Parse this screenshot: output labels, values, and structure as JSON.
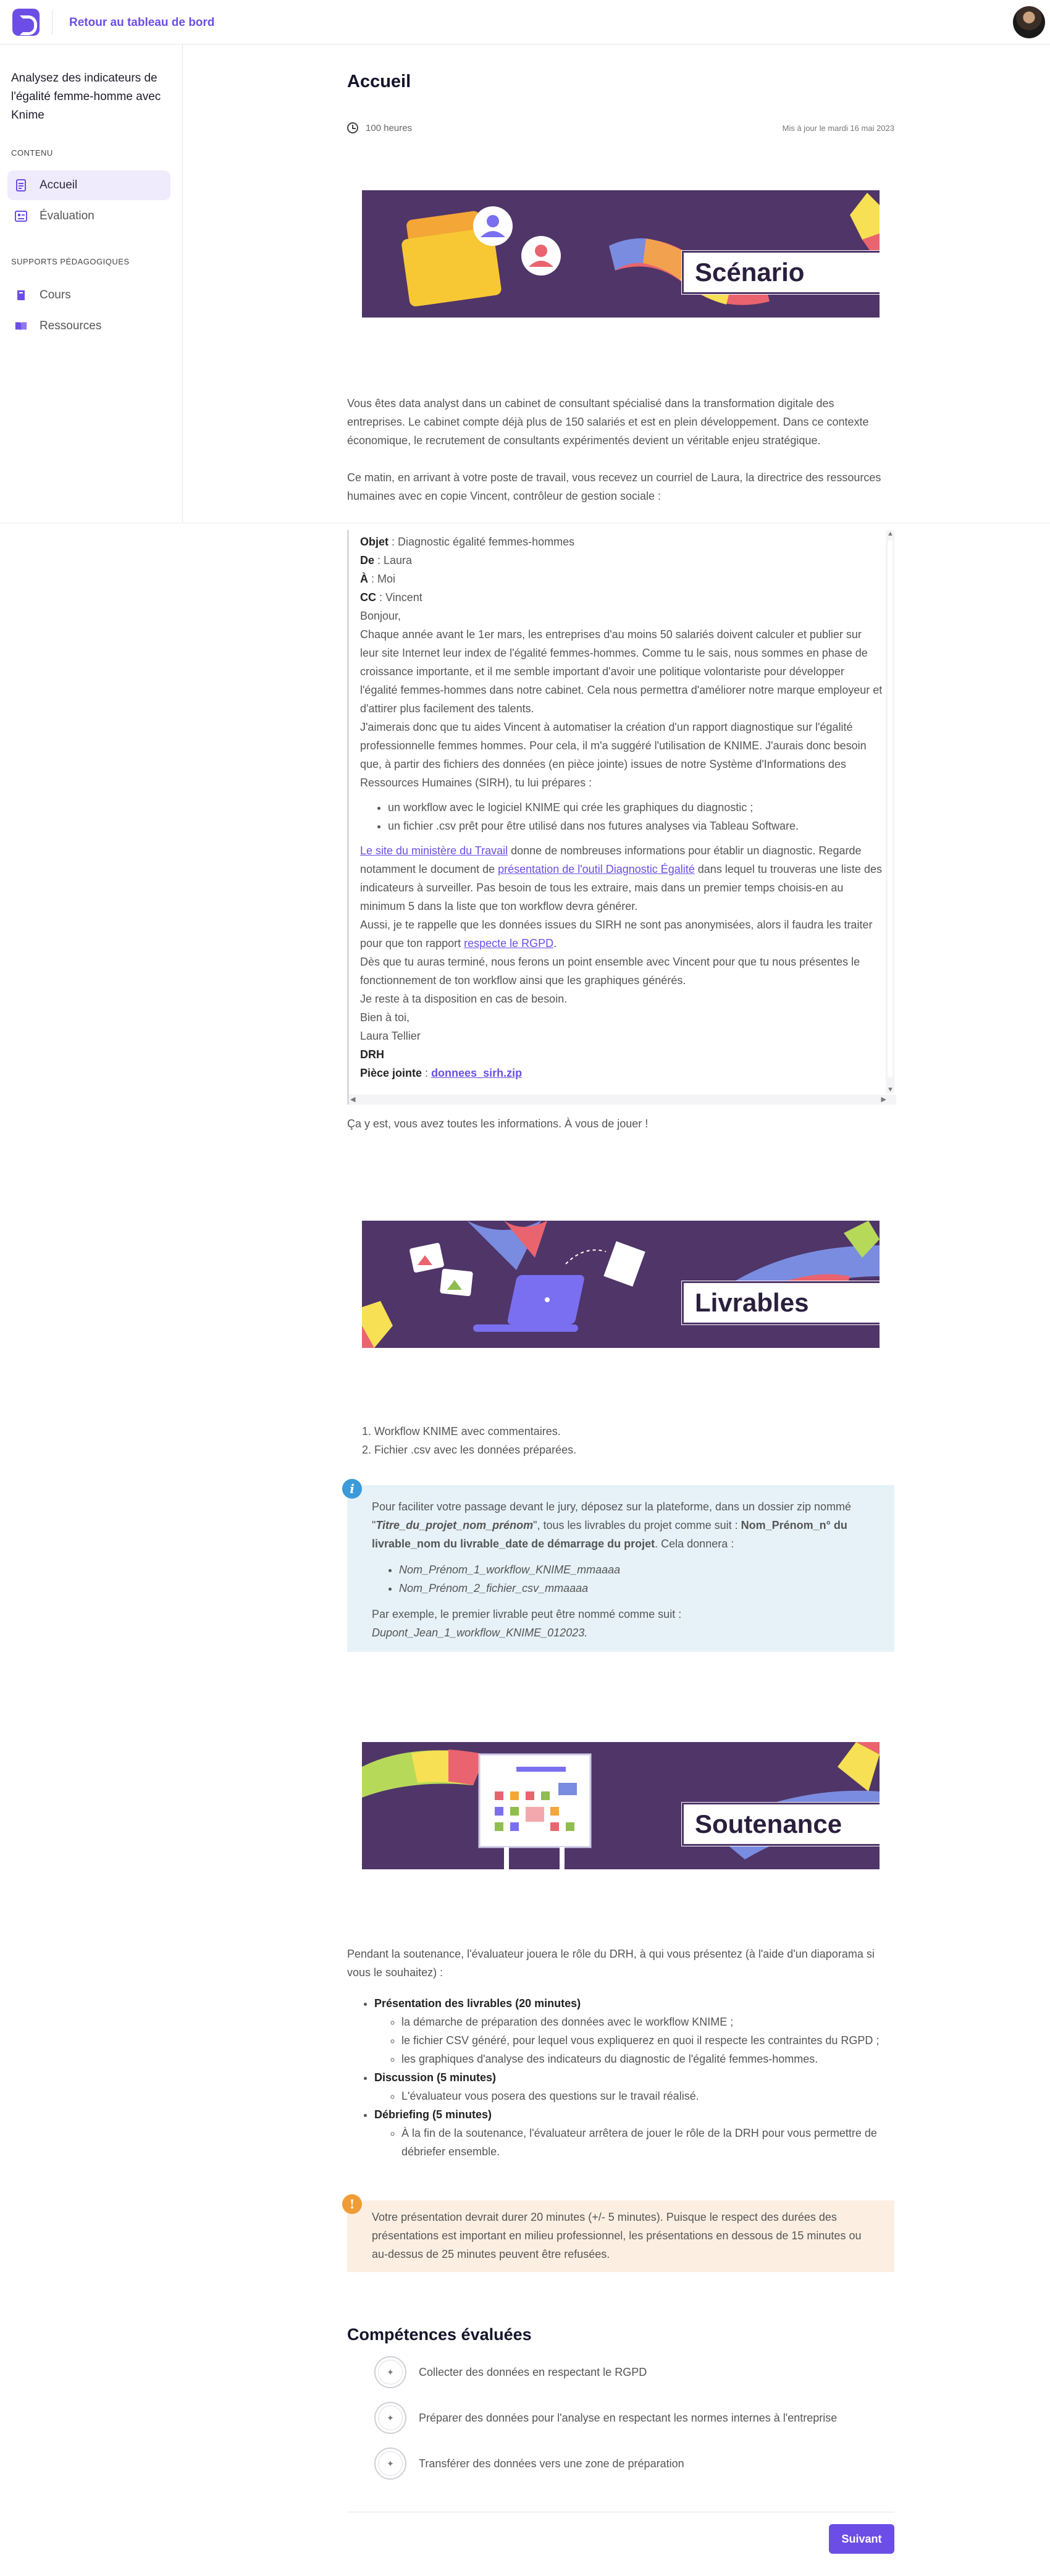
{
  "header": {
    "back_link": "Retour au tableau de bord"
  },
  "sidebar": {
    "course_title": "Analysez des indicateurs de l'égalité femme-homme avec Knime",
    "section_content": "CONTENU",
    "items_content": [
      {
        "label": "Accueil",
        "icon": "document-icon",
        "active": true
      },
      {
        "label": "Évaluation",
        "icon": "quiz-icon",
        "active": false
      }
    ],
    "section_support": "SUPPORTS PÉDAGOGIQUES",
    "items_support": [
      {
        "label": "Cours",
        "icon": "book-icon"
      },
      {
        "label": "Ressources",
        "icon": "book-open-icon"
      }
    ]
  },
  "main": {
    "title": "Accueil",
    "duration": "100 heures",
    "updated": "Mis à jour le mardi 16 mai 2023",
    "banner1": "Scénario",
    "intro": "Vous êtes data analyst dans un cabinet de consultant spécialisé dans la transformation digitale des entreprises. Le cabinet compte déjà plus de 150 salariés et est en plein développement. Dans ce contexte économique, le recrutement de consultants expérimentés devient un véritable enjeu stratégique.",
    "intro2": "Ce matin, en arrivant à votre poste de travail, vous recevez un courriel de Laura, la directrice des ressources humaines avec en copie Vincent, contrôleur de gestion sociale :",
    "email": {
      "objet_label": "Objet",
      "objet": " : Diagnostic égalité femmes-hommes",
      "de_label": "De",
      "de": " : Laura",
      "a_label": "À",
      "a": " : Moi",
      "cc_label": "CC",
      "cc": " : Vincent",
      "greeting": "Bonjour,",
      "p1": "Chaque année avant le 1er mars, les entreprises d'au moins 50 salariés doivent calculer et publier sur leur site Internet leur index de l'égalité femmes-hommes. Comme tu le sais, nous sommes en phase de croissance importante, et il me semble important d'avoir une politique volontariste pour développer l'égalité femmes-hommes dans notre cabinet. Cela nous permettra d'améliorer notre marque employeur et d'attirer plus facilement des talents.",
      "p2": "J'aimerais donc que tu aides Vincent à automatiser la création d'un rapport diagnostique sur l'égalité professionnelle femmes hommes. Pour cela, il m'a suggéré l'utilisation de KNIME. J'aurais donc besoin que, à partir des fichiers des données (en pièce jointe) issues de notre Système d'Informations des Ressources Humaines (SIRH), tu lui prépares :",
      "bullets": [
        "un workflow avec le logiciel KNIME qui crée les graphiques du diagnostic ;",
        "un fichier .csv prêt pour être utilisé dans nos futures analyses via Tableau Software."
      ],
      "link1": "Le site du ministère du Travail",
      "p3a": " donne de nombreuses informations pour établir un diagnostic. Regarde notamment le document de ",
      "link2": "présentation de l'outil Diagnostic Égalité",
      "p3b": " dans lequel tu trouveras une liste des indicateurs à surveiller. Pas besoin de tous les extraire, mais dans un premier temps choisis-en au minimum 5 dans la liste que ton workflow devra générer.",
      "p4a": "Aussi, je te rappelle que les données issues du SIRH ne sont pas anonymisées, alors il faudra les traiter pour que ton rapport ",
      "link3": "respecte le RGPD",
      "p4b": ".",
      "p5": "Dès que tu auras terminé, nous ferons un point ensemble avec Vincent pour que tu nous présentes le fonctionnement de ton workflow ainsi que les graphiques générés.",
      "p6": "Je reste à ta disposition en cas de besoin.",
      "p7": "Bien à toi,",
      "sign1": "Laura Tellier",
      "sign2": "DRH",
      "pj_label": "Pièce jointe",
      "pj_sep": " : ",
      "pj_file": "donnees_sirh.zip"
    },
    "after_email": "Ça y est, vous avez toutes les informations. À vous de jouer !",
    "banner2": "Livrables",
    "deliverables": [
      "Workflow KNIME avec commentaires.",
      "Fichier .csv avec les données préparées."
    ],
    "info": {
      "p1a": "Pour faciliter votre passage devant le jury, déposez sur la plateforme, dans un dossier zip nommé \"",
      "p1b": "Titre_du_projet_nom_prénom",
      "p1c": "\", tous les livrables du projet comme suit : ",
      "p1d": "Nom_Prénom_n° du livrable_nom du livrable_date de démarrage du projet",
      "p1e": ". Cela donnera :",
      "examples": [
        "Nom_Prénom_1_workflow_KNIME_mmaaaa",
        "Nom_Prénom_2_fichier_csv_mmaaaa"
      ],
      "p2": "Par exemple, le premier livrable peut être nommé comme suit : ",
      "p2ex": "Dupont_Jean_1_workflow_KNIME_012023."
    },
    "banner3": "Soutenance",
    "soutenance_intro": "Pendant la soutenance, l'évaluateur jouera le rôle du DRH, à qui vous présentez (à l'aide d'un diaporama si vous le souhaitez) :",
    "soutenance": [
      {
        "title": "Présentation des livrables (20 minutes)",
        "items": [
          "la démarche de préparation des données avec le workflow KNIME ;",
          "le fichier CSV généré, pour lequel vous expliquerez en quoi il respecte les contraintes du RGPD ;",
          "les graphiques d'analyse des indicateurs du diagnostic de l'égalité femmes-hommes."
        ]
      },
      {
        "title": "Discussion (5 minutes)",
        "items": [
          "L'évaluateur vous posera des questions sur le travail réalisé."
        ]
      },
      {
        "title": "Débriefing (5 minutes)",
        "items": [
          "À la fin de la soutenance, l'évaluateur arrêtera de jouer le rôle de la DRH pour vous permettre de débriefer ensemble."
        ]
      }
    ],
    "warning": "Votre présentation devrait durer 20 minutes (+/- 5 minutes). Puisque le respect des durées des présentations est important en milieu professionnel, les présentations en dessous de 15 minutes ou au-dessus de 25 minutes peuvent être refusées.",
    "competences_title": "Compétences évaluées",
    "competences": [
      "Collecter des données en respectant le RGPD",
      "Préparer des données pour l'analyse en respectant les normes internes à l'entreprise",
      "Transférer des données vers une zone de préparation"
    ],
    "next_button": "Suivant"
  },
  "colors": {
    "accent": "#6c4ee6",
    "banner_bg": "#4f3568",
    "info_bg": "#e6f2f8",
    "warning_bg": "#fcefe2",
    "info_icon": "#3b9ad9",
    "warning_icon": "#f09c36"
  }
}
